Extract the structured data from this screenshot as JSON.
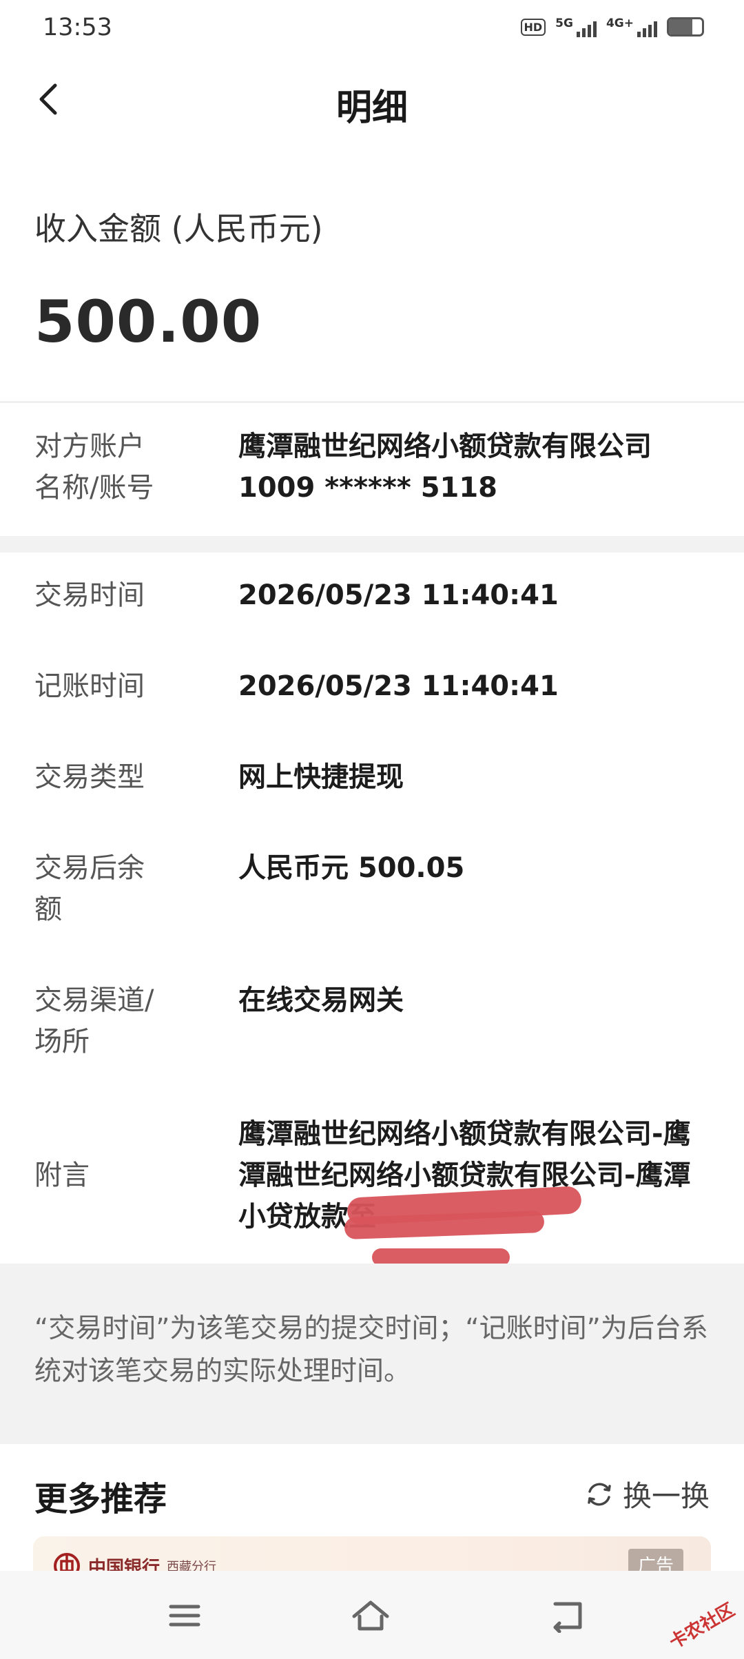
{
  "status_bar": {
    "time": "13:53",
    "hd": "HD",
    "sim1": "5G",
    "sim2": "4G+",
    "battery_level": 0.7
  },
  "header": {
    "title": "明细"
  },
  "amount": {
    "label": "收入金额 (人民币元)",
    "value": "500.00"
  },
  "counterparty": {
    "key_line1": "对方账户",
    "key_line2": "名称/账号",
    "name": "鹰潭融世纪网络小额贷款有限公司",
    "account": "1009 ****** 5118"
  },
  "details": [
    {
      "key": "交易时间",
      "value": "2026/05/23 11:40:41"
    },
    {
      "key": "记账时间",
      "value": "2026/05/23 11:40:41"
    },
    {
      "key": "交易类型",
      "value": "网上快捷提现"
    },
    {
      "key_line1": "交易后余",
      "key_line2": "额",
      "value": "人民币元 500.05"
    },
    {
      "key_line1": "交易渠道/",
      "key_line2": "场所",
      "value": "在线交易网关"
    }
  ],
  "memo": {
    "key": "附言",
    "line1": "鹰潭融世纪网络小额贷款有限公司-鹰",
    "line2": "潭融世纪网络小额贷款有限公司-鹰潭",
    "line3": "小贷放款至"
  },
  "note": "“交易时间”为该笔交易的提交时间；“记账时间”为后台系统对该笔交易的实际处理时间。",
  "recommend": {
    "title": "更多推荐",
    "refresh_label": "换一换"
  },
  "ad": {
    "bank": "中国银行",
    "branch": "西藏分行",
    "badge": "广告"
  },
  "watermark": "卡农社区",
  "colors": {
    "redaction": "#d9545c",
    "band": "#f2f2f2"
  }
}
